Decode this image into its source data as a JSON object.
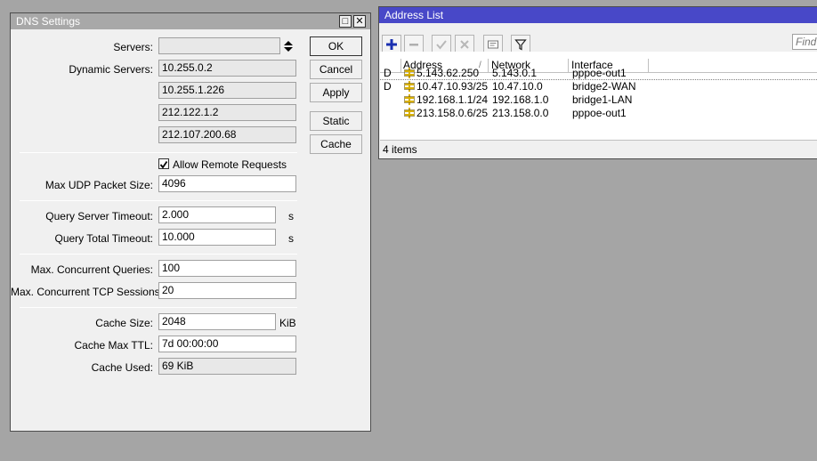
{
  "dns": {
    "title": "DNS Settings",
    "servers_label": "Servers:",
    "servers_value": "",
    "dynamic_servers_label": "Dynamic Servers:",
    "dynamic_servers": [
      "10.255.0.2",
      "10.255.1.226",
      "212.122.1.2",
      "212.107.200.68"
    ],
    "allow_remote_requests_label": "Allow Remote Requests",
    "allow_remote_requests": true,
    "max_udp_label": "Max UDP Packet Size:",
    "max_udp_value": "4096",
    "query_server_timeout_label": "Query Server Timeout:",
    "query_server_timeout_value": "2.000",
    "query_server_timeout_unit": "s",
    "query_total_timeout_label": "Query Total Timeout:",
    "query_total_timeout_value": "10.000",
    "query_total_timeout_unit": "s",
    "max_concurrent_queries_label": "Max. Concurrent Queries:",
    "max_concurrent_queries_value": "100",
    "max_concurrent_tcp_label": "Max. Concurrent TCP Sessions:",
    "max_concurrent_tcp_value": "20",
    "cache_size_label": "Cache Size:",
    "cache_size_value": "2048",
    "cache_size_unit": "KiB",
    "cache_max_ttl_label": "Cache Max TTL:",
    "cache_max_ttl_value": "7d 00:00:00",
    "cache_used_label": "Cache Used:",
    "cache_used_value": "69 KiB",
    "buttons": {
      "ok": "OK",
      "cancel": "Cancel",
      "apply": "Apply",
      "static": "Static",
      "cache": "Cache"
    },
    "restore_glyph": "□",
    "close_glyph": "✕"
  },
  "address_list": {
    "title": "Address List",
    "find_placeholder": "Find",
    "columns": {
      "address": "Address",
      "sort_indicator": "/",
      "network": "Network",
      "interface": "Interface"
    },
    "rows": [
      {
        "flag": "D",
        "address": "5.143.62.250",
        "network": "5.143.0.1",
        "interface": "pppoe-out1"
      },
      {
        "flag": "D",
        "address": "10.47.10.93/25",
        "network": "10.47.10.0",
        "interface": "bridge2-WAN"
      },
      {
        "flag": "",
        "address": "192.168.1.1/24",
        "network": "192.168.1.0",
        "interface": "bridge1-LAN"
      },
      {
        "flag": "",
        "address": "213.158.0.6/25",
        "network": "213.158.0.0",
        "interface": "pppoe-out1"
      }
    ],
    "status": "4 items"
  },
  "icons": {
    "add": "add-icon",
    "remove": "remove-icon",
    "enable": "check-icon",
    "disable": "disable-icon",
    "comment": "comment-icon",
    "filter": "filter-icon",
    "address_row": "address-icon"
  },
  "colors": {
    "active_title": "#4848c8",
    "inactive_title": "#a8a8a8",
    "desktop": "#a5a5a5",
    "add_icon": "#1a2fb0",
    "address_icon": "#d8b000"
  }
}
